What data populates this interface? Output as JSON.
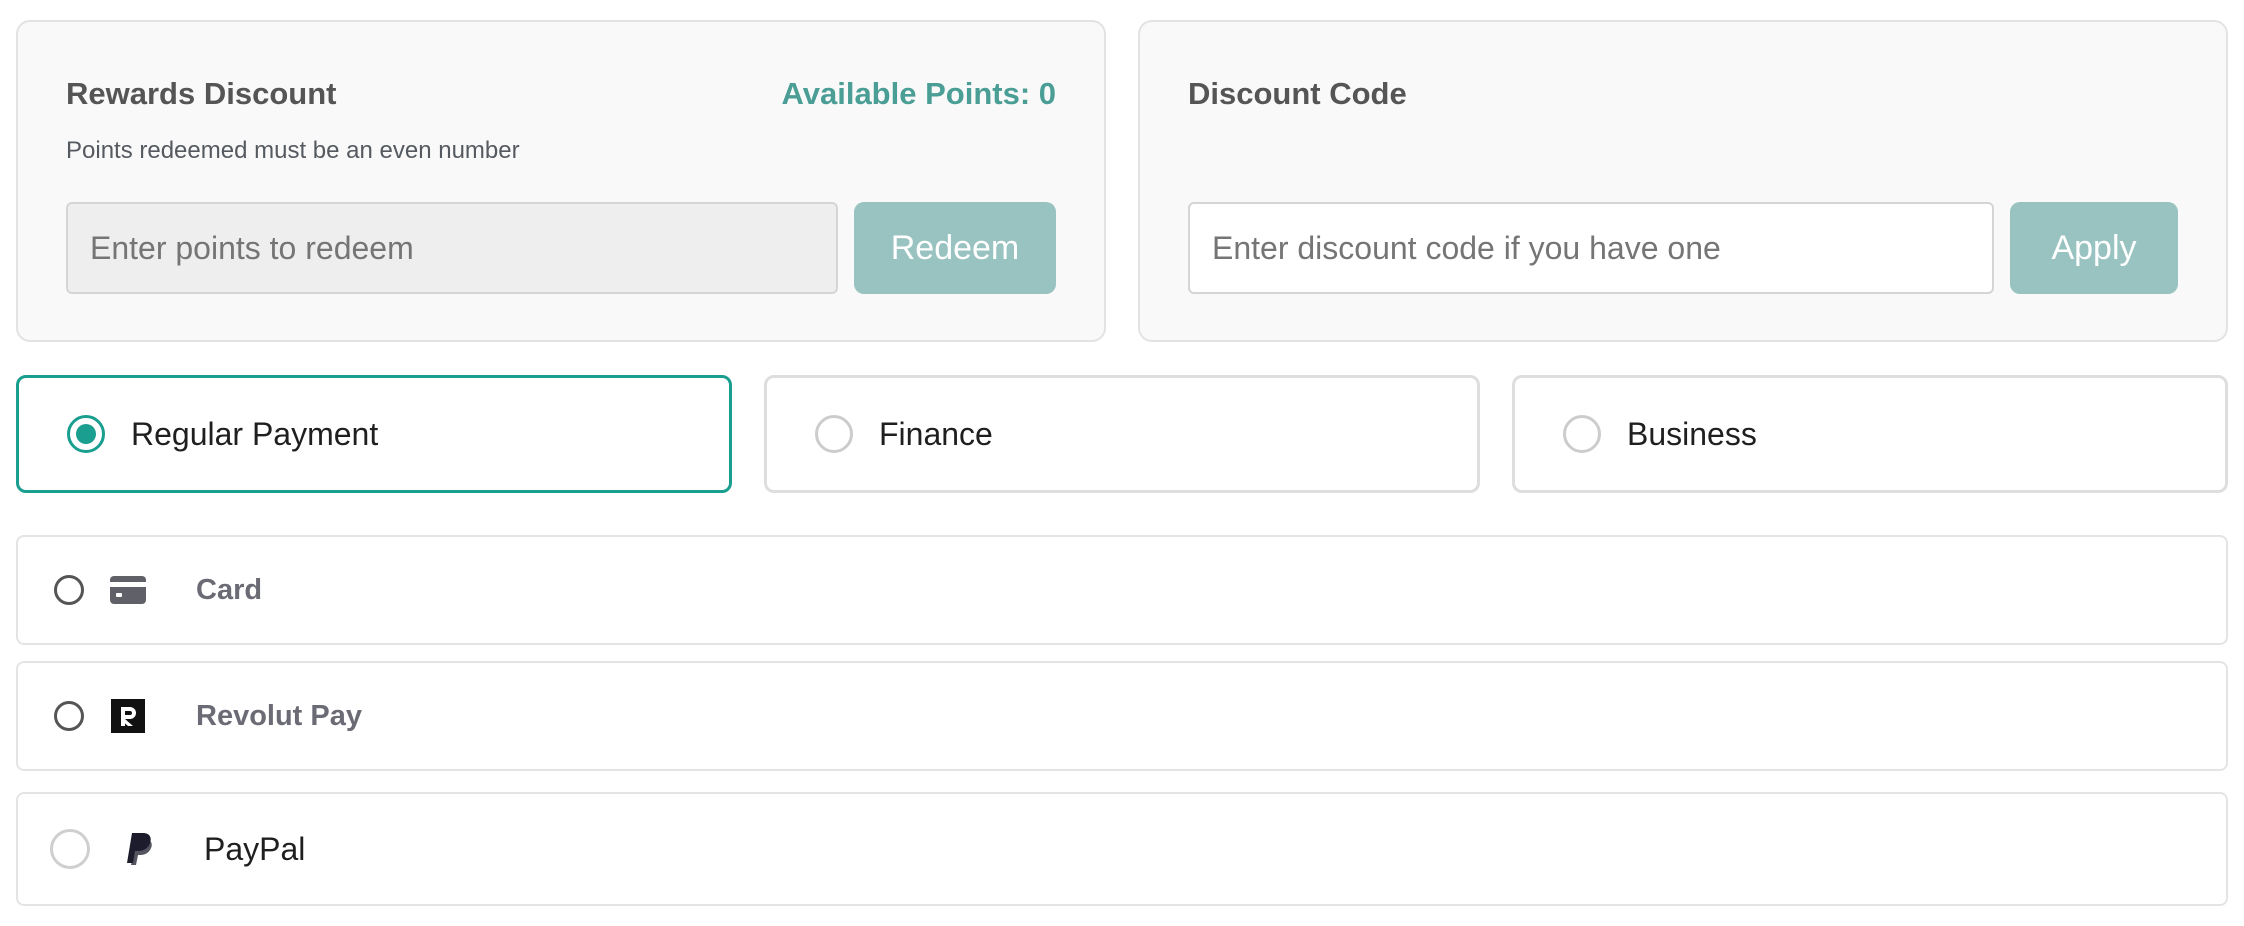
{
  "colors": {
    "accent": "#1a9e8f",
    "points": "#4a9e95",
    "button": "#99c3c0"
  },
  "rewards": {
    "title": "Rewards Discount",
    "available_points": "Available Points: 0",
    "hint": "Points redeemed must be an even number",
    "input_placeholder": "Enter points to redeem",
    "button_label": "Redeem"
  },
  "discount": {
    "title": "Discount Code",
    "input_placeholder": "Enter discount code if you have one",
    "button_label": "Apply"
  },
  "payment_types": [
    {
      "label": "Regular Payment",
      "selected": true
    },
    {
      "label": "Finance",
      "selected": false
    },
    {
      "label": "Business",
      "selected": false
    }
  ],
  "payment_methods": [
    {
      "label": "Card",
      "icon": "credit-card-icon"
    },
    {
      "label": "Revolut Pay",
      "icon": "revolut-icon"
    },
    {
      "label": "PayPal",
      "icon": "paypal-icon"
    }
  ]
}
